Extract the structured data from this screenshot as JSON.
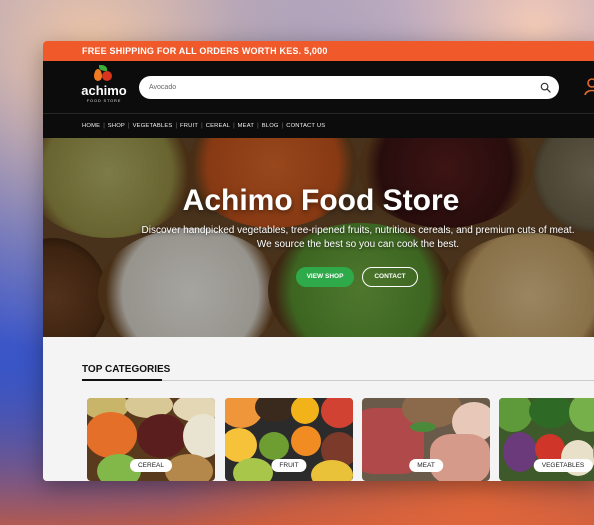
{
  "promo": {
    "text": "FREE SHIPPING FOR ALL ORDERS WORTH KES. 5,000"
  },
  "logo": {
    "name": "achimo",
    "tagline": "FOOD STORE"
  },
  "search": {
    "value": "Avocado"
  },
  "nav": {
    "items": [
      "HOME",
      "SHOP",
      "VEGETABLES",
      "FRUIT",
      "CEREAL",
      "MEAT",
      "BLOG",
      "CONTACT US"
    ]
  },
  "hero": {
    "title": "Achimo Food Store",
    "description": "Discover handpicked vegetables, tree-ripened fruits, nutritious cereals, and premium cuts of meat. We source the best so you can cook the best.",
    "shop_label": "VIEW SHOP",
    "contact_label": "CONTACT"
  },
  "categories": {
    "title": "TOP CATEGORIES",
    "items": [
      {
        "label": "CEREAL"
      },
      {
        "label": "FRUIT"
      },
      {
        "label": "MEAT"
      },
      {
        "label": "VEGETABLES"
      }
    ]
  },
  "colors": {
    "accent": "#f0592a",
    "header": "#0c0c0c",
    "button": "#2eaa4a"
  },
  "icons": {
    "search": "search-icon",
    "user": "user-icon"
  }
}
